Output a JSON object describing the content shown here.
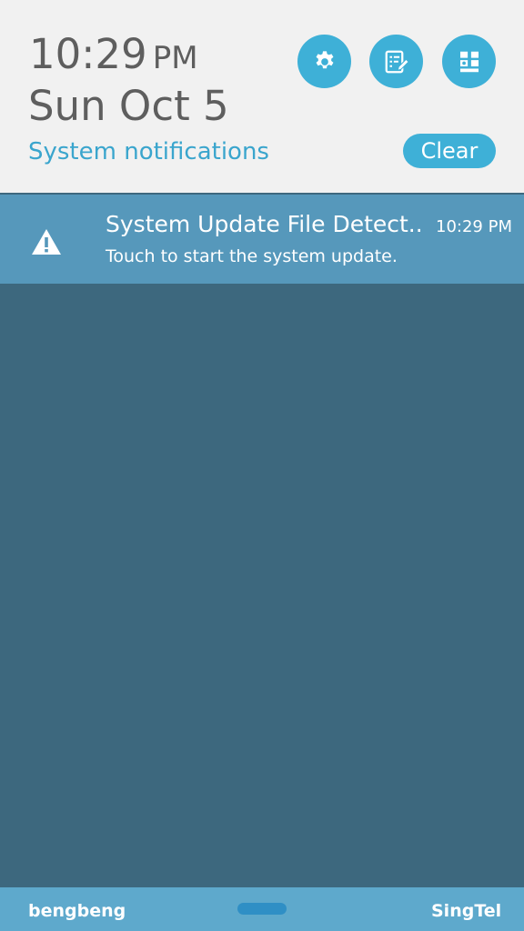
{
  "header": {
    "time": "10:29",
    "ampm": "PM",
    "date": "Sun Oct 5",
    "section_label": "System notifications",
    "clear_label": "Clear",
    "quick_buttons": [
      {
        "icon": "gear-icon"
      },
      {
        "icon": "edit-icon"
      },
      {
        "icon": "grid-icon"
      }
    ]
  },
  "notifications": [
    {
      "icon": "warning-icon",
      "title": "System Update File Detect..",
      "time": "10:29 PM",
      "body": "Touch to start the system update."
    }
  ],
  "footer": {
    "carrier_left": "bengbeng",
    "carrier_right": "SingTel"
  },
  "colors": {
    "header_bg": "#f1f1f1",
    "accent": "#3eb0d7",
    "notification_bg": "#5698bb",
    "shade_bg": "#3d687e",
    "footer_bg": "#5ea9cc"
  }
}
